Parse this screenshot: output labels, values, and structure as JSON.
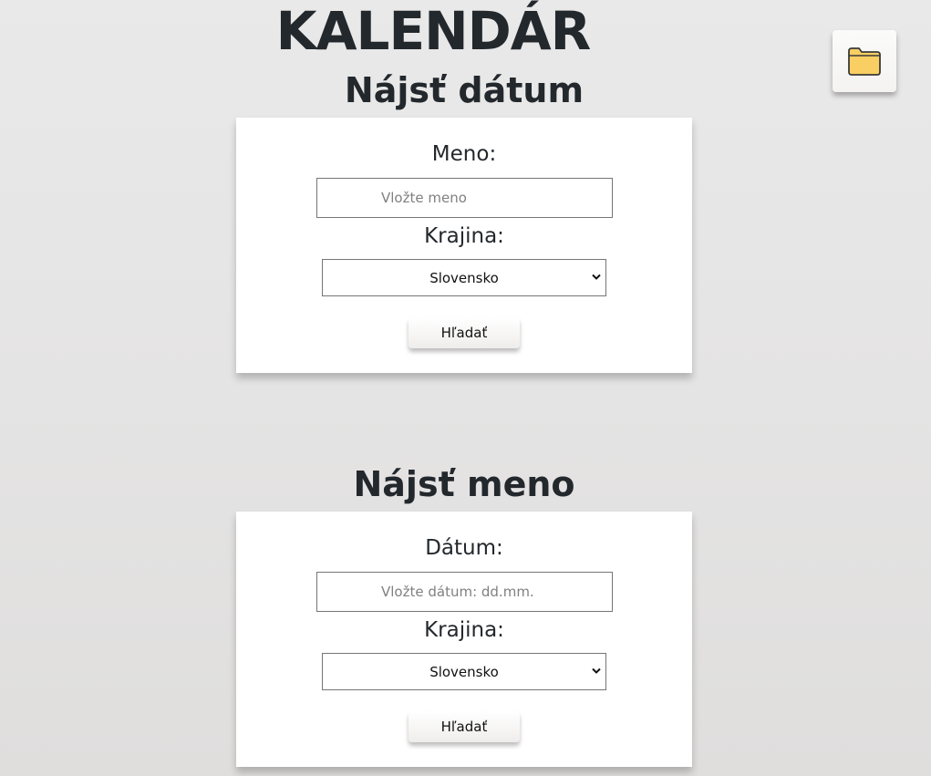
{
  "header": {
    "title": "KALENDÁR"
  },
  "toolbar": {
    "folder_icon": "folder-icon"
  },
  "find_date": {
    "title": "Nájsť dátum",
    "name_label": "Meno:",
    "name_value": "",
    "name_placeholder": "Vložte meno",
    "country_label": "Krajina:",
    "country_selected": "Slovensko",
    "search_label": "Hľadať"
  },
  "find_name": {
    "title": "Nájsť meno",
    "date_label": "Dátum:",
    "date_value": "",
    "date_placeholder": "Vložte dátum: dd.mm.",
    "country_label": "Krajina:",
    "country_selected": "Slovensko",
    "search_label": "Hľadať"
  },
  "colors": {
    "folder_fill": "#f9cf63",
    "folder_stroke": "#3a3a3a",
    "text": "#23282d"
  }
}
